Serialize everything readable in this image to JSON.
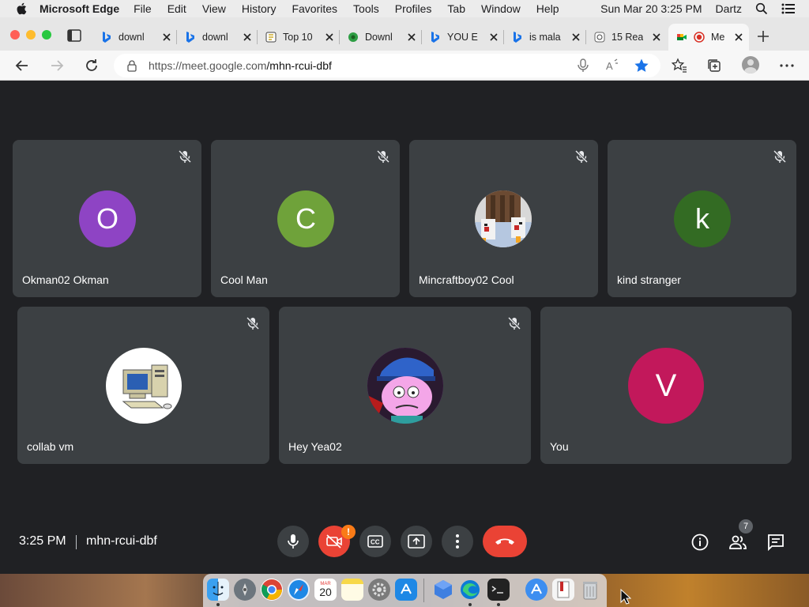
{
  "menubar": {
    "app_name": "Microsoft Edge",
    "items": [
      "File",
      "Edit",
      "View",
      "History",
      "Favorites",
      "Tools",
      "Profiles",
      "Tab",
      "Window",
      "Help"
    ],
    "datetime": "Sun Mar 20  3:25 PM",
    "user": "Dartz"
  },
  "tabs": [
    {
      "title": "downl",
      "icon": "bing-icon"
    },
    {
      "title": "downl",
      "icon": "bing-icon"
    },
    {
      "title": "Top 10",
      "icon": "paper-icon"
    },
    {
      "title": "Downl",
      "icon": "green-logo-icon"
    },
    {
      "title": "YOU E",
      "icon": "bing-icon"
    },
    {
      "title": "is mala",
      "icon": "bing-icon"
    },
    {
      "title": "15 Rea",
      "icon": "site-icon"
    },
    {
      "title": "Me",
      "icon": "meet-icon"
    }
  ],
  "address": {
    "url_host": "https://meet.google.com",
    "url_path": "/mhn-rcui-dbf"
  },
  "participants": [
    {
      "name": "Okman02 Okman",
      "initial": "O",
      "color": "#8e44c4",
      "muted": true
    },
    {
      "name": "Cool Man",
      "initial": "C",
      "color": "#6fa23a",
      "muted": true
    },
    {
      "name": "Mincraftboy02 Cool",
      "initial": "",
      "color": "#8a6a55",
      "muted": true
    },
    {
      "name": "kind stranger",
      "initial": "k",
      "color": "#336b23",
      "muted": true
    },
    {
      "name": "collab vm",
      "initial": "",
      "color": "#ffffff",
      "muted": true
    },
    {
      "name": "Hey Yea02",
      "initial": "",
      "color": "#8a3aa8",
      "muted": true
    },
    {
      "name": "You",
      "initial": "V",
      "color": "#c2185b",
      "muted": false
    }
  ],
  "meeting": {
    "time": "3:25 PM",
    "code": "mhn-rcui-dbf",
    "camera_warning": "!",
    "participant_count": "7"
  },
  "colors": {
    "stage": "#202124",
    "tile": "#3c4043",
    "end_call": "#ea4335",
    "warning": "#fa7b17"
  },
  "dock": {
    "apps": [
      "finder-icon",
      "launchpad-icon",
      "chrome-icon",
      "safari-icon",
      "calendar-icon",
      "notes-icon",
      "system-preferences-icon",
      "app-store-icon",
      "virtualbox-icon",
      "edge-icon",
      "terminal-icon",
      "downloads-icon",
      "documents-icon",
      "trash-icon"
    ],
    "calendar_day": "20",
    "calendar_month": "MAR"
  }
}
